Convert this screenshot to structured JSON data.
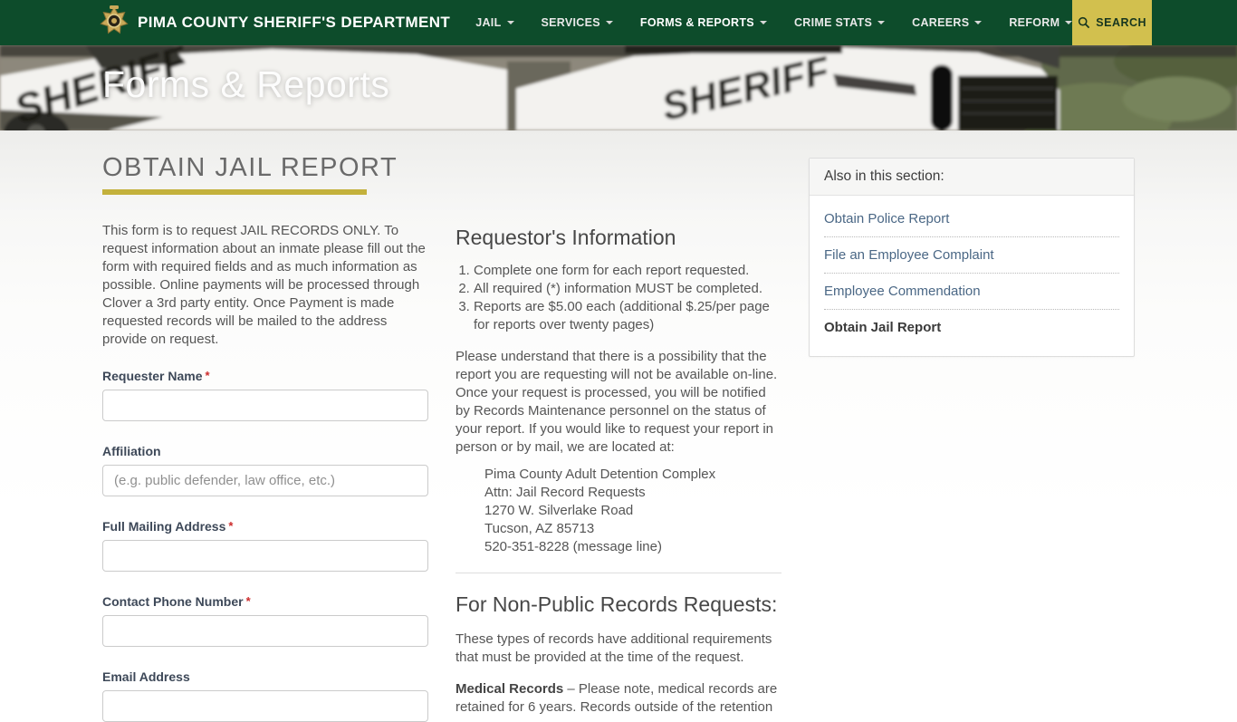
{
  "colors": {
    "nav_green": "#0d4c2b",
    "search_gold": "#d2c04e",
    "underline_gold": "#c3b13c",
    "link_blue": "#4a6785",
    "required_red": "#cc2b2b"
  },
  "nav": {
    "brand": "PIMA COUNTY SHERIFF'S DEPARTMENT",
    "items": [
      {
        "label": "JAIL"
      },
      {
        "label": "SERVICES"
      },
      {
        "label": "FORMS & REPORTS"
      },
      {
        "label": "CRIME STATS"
      },
      {
        "label": "CAREERS"
      },
      {
        "label": "REFORM"
      }
    ],
    "search_label": "SEARCH"
  },
  "hero": {
    "title": "Forms & Reports",
    "vehicle_text": "SHERIFF"
  },
  "page": {
    "title": "OBTAIN JAIL REPORT"
  },
  "form": {
    "required_marker": "*",
    "intro": "This form is to request JAIL RECORDS ONLY. To request information about an inmate please fill out the form with required fields and as much information as possible. Online payments will be processed through Clover a 3rd party entity. Once Payment is made requested records will be mailed to the address provide on request.",
    "fields": [
      {
        "label": "Requester Name",
        "required": true,
        "placeholder": "",
        "value": ""
      },
      {
        "label": "Affiliation",
        "required": false,
        "placeholder": "(e.g. public defender, law office, etc.)",
        "value": ""
      },
      {
        "label": "Full Mailing Address",
        "required": true,
        "placeholder": "",
        "value": ""
      },
      {
        "label": "Contact Phone Number",
        "required": true,
        "placeholder": "",
        "value": ""
      },
      {
        "label": "Email Address",
        "required": false,
        "placeholder": "",
        "value": ""
      }
    ]
  },
  "info": {
    "heading": "Requestor's Information",
    "list": [
      "Complete one form for each report requested.",
      "All required (*) information MUST be completed.",
      "Reports are $5.00 each (additional $.25/per page for reports over twenty pages)"
    ],
    "paragraph": "Please understand that there is a possibility that the report you are requesting will not be available on-line. Once your request is processed, you will be notified by Records Maintenance personnel on the status of your report. If you would like to request your report in person or by mail, we are located at:",
    "address": [
      "Pima County Adult Detention Complex",
      "Attn: Jail Record Requests",
      "1270 W. Silverlake Road",
      "Tucson, AZ 85713",
      "520-351-8228 (message line)"
    ],
    "nonpublic_heading": "For Non-Public Records Requests:",
    "nonpublic_text": "These types of records have additional requirements that must be provided at the time of the request.",
    "medical_bold": "Medical Records",
    "medical_text": " – Please note, medical records are retained for 6 years. Records outside of the retention"
  },
  "sidebar": {
    "heading": "Also in this section:",
    "links": [
      {
        "label": "Obtain Police Report"
      },
      {
        "label": "File an Employee Complaint"
      },
      {
        "label": "Employee Commendation"
      },
      {
        "label": "Obtain Jail Report"
      }
    ]
  }
}
